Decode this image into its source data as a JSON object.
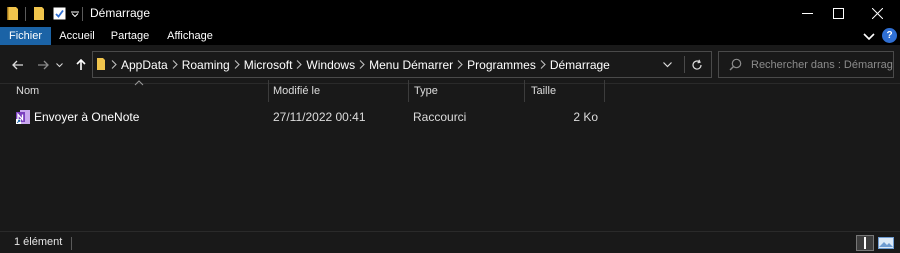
{
  "window": {
    "title": "Démarrage"
  },
  "ribbon": {
    "tabs": [
      "Fichier",
      "Accueil",
      "Partage",
      "Affichage"
    ]
  },
  "address": {
    "crumbs": [
      "AppData",
      "Roaming",
      "Microsoft",
      "Windows",
      "Menu Démarrer",
      "Programmes",
      "Démarrage"
    ]
  },
  "search": {
    "placeholder": "Rechercher dans : Démarrage"
  },
  "columns": {
    "name": "Nom",
    "modified": "Modifié le",
    "type": "Type",
    "size": "Taille"
  },
  "files": [
    {
      "name": "Envoyer à OneNote",
      "modified": "27/11/2022 00:41",
      "type": "Raccourci",
      "size": "2 Ko"
    }
  ],
  "status": {
    "count": "1 élément"
  },
  "colors": {
    "accent": "#1b63a6",
    "folder": "#f0c44c",
    "onenote": "#7b3fbf",
    "help": "#2f6fd3"
  }
}
